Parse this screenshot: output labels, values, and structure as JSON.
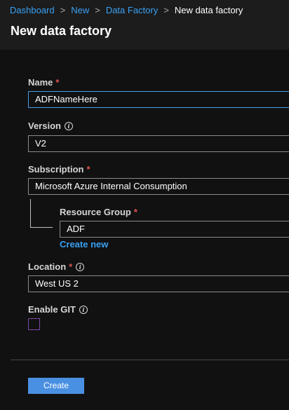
{
  "breadcrumb": {
    "items": [
      "Dashboard",
      "New",
      "Data Factory"
    ],
    "current": "New data factory",
    "separator": ">"
  },
  "page_title": "New data factory",
  "form": {
    "name": {
      "label": "Name",
      "required": "*",
      "value": "ADFNameHere"
    },
    "version": {
      "label": "Version",
      "info_icon": "info-icon",
      "value": "V2"
    },
    "subscription": {
      "label": "Subscription",
      "required": "*",
      "value": "Microsoft Azure Internal Consumption"
    },
    "resource_group": {
      "label": "Resource Group",
      "required": "*",
      "value": "ADF",
      "create_new": "Create new"
    },
    "location": {
      "label": "Location",
      "required": "*",
      "info_icon": "info-icon",
      "value": "West US 2"
    },
    "enable_git": {
      "label": "Enable GIT",
      "info_icon": "info-icon",
      "checked": false
    }
  },
  "actions": {
    "create_label": "Create"
  },
  "colors": {
    "background": "#111111",
    "header": "#1c1c1c",
    "link": "#3aa0f3",
    "required": "#e05252",
    "primary_button": "#4a90e2",
    "focus_border": "#4a9fe8",
    "checkbox_border": "#7d45a8"
  }
}
